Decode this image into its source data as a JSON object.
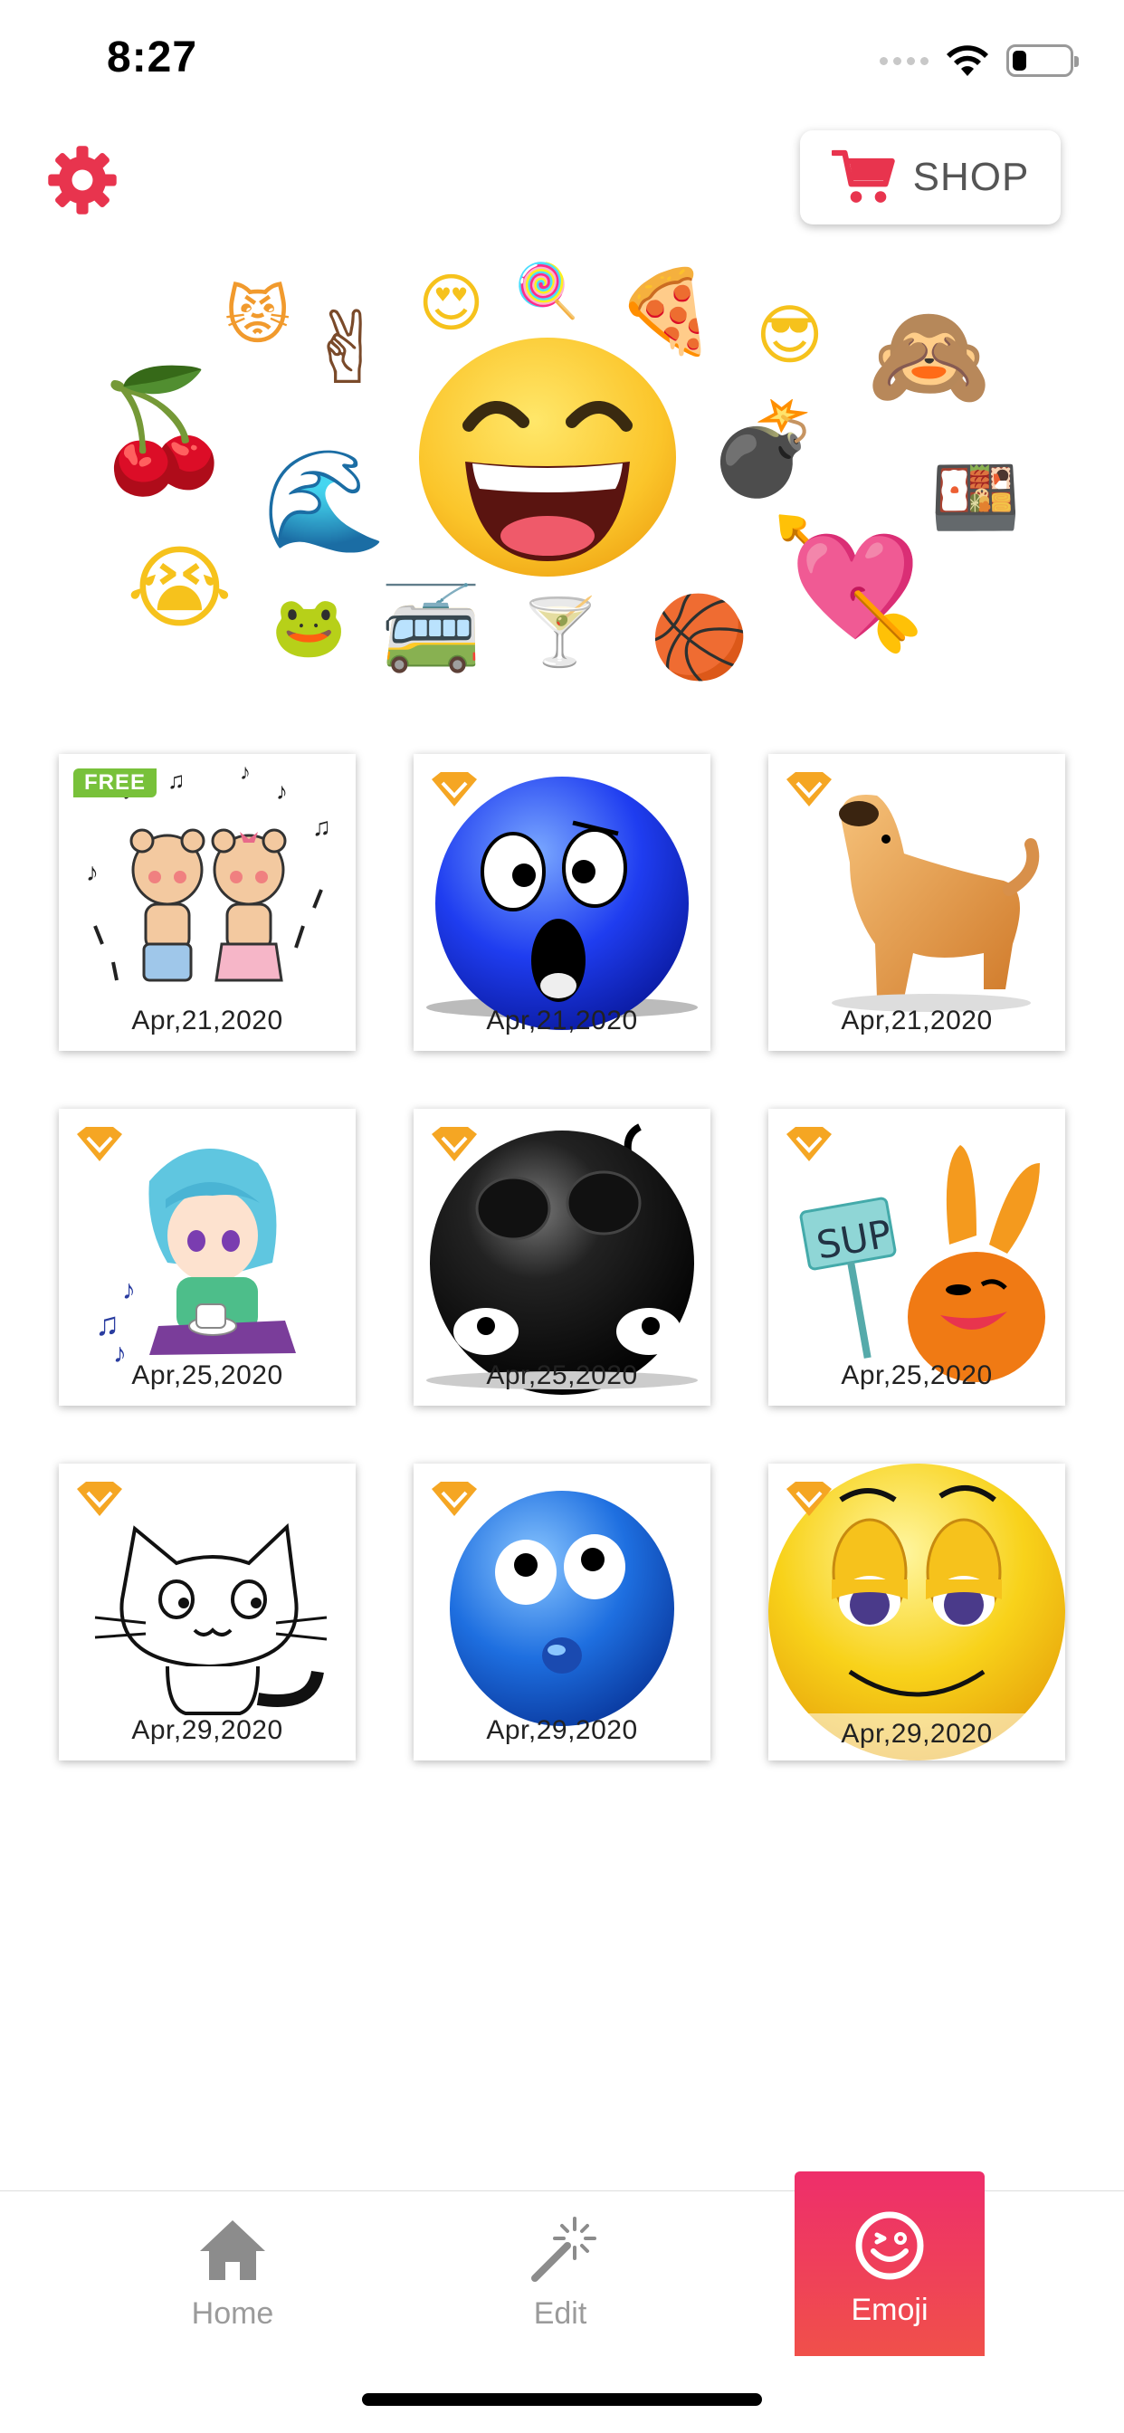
{
  "status_bar": {
    "time": "8:27",
    "battery_level": 0.25
  },
  "header": {
    "settings_icon": "gear-icon",
    "shop_label": "SHOP",
    "accent_color": "#e8344e"
  },
  "hero": {
    "emojis": [
      "😾",
      "✌🏾",
      "😍",
      "🍭",
      "🍕",
      "😎",
      "🙈",
      "🍒",
      "🌊",
      "💣",
      "🍱",
      "😭",
      "🐸",
      "🚎",
      "🍸",
      "🏀",
      "💘",
      "😆"
    ]
  },
  "stickers": [
    {
      "date": "Apr,21,2020",
      "badge": "FREE"
    },
    {
      "date": "Apr,21,2020",
      "badge": "vip"
    },
    {
      "date": "Apr,21,2020",
      "badge": "vip"
    },
    {
      "date": "Apr,25,2020",
      "badge": "vip"
    },
    {
      "date": "Apr,25,2020",
      "badge": "vip"
    },
    {
      "date": "Apr,25,2020",
      "badge": "vip"
    },
    {
      "date": "Apr,29,2020",
      "badge": "vip"
    },
    {
      "date": "Apr,29,2020",
      "badge": "vip"
    },
    {
      "date": "Apr,29,2020",
      "badge": "vip"
    }
  ],
  "tabs": [
    {
      "label": "Home",
      "icon": "home-icon",
      "active": false
    },
    {
      "label": "Edit",
      "icon": "magic-wand-icon",
      "active": false
    },
    {
      "label": "Emoji",
      "icon": "emoji-face-icon",
      "active": true
    }
  ]
}
